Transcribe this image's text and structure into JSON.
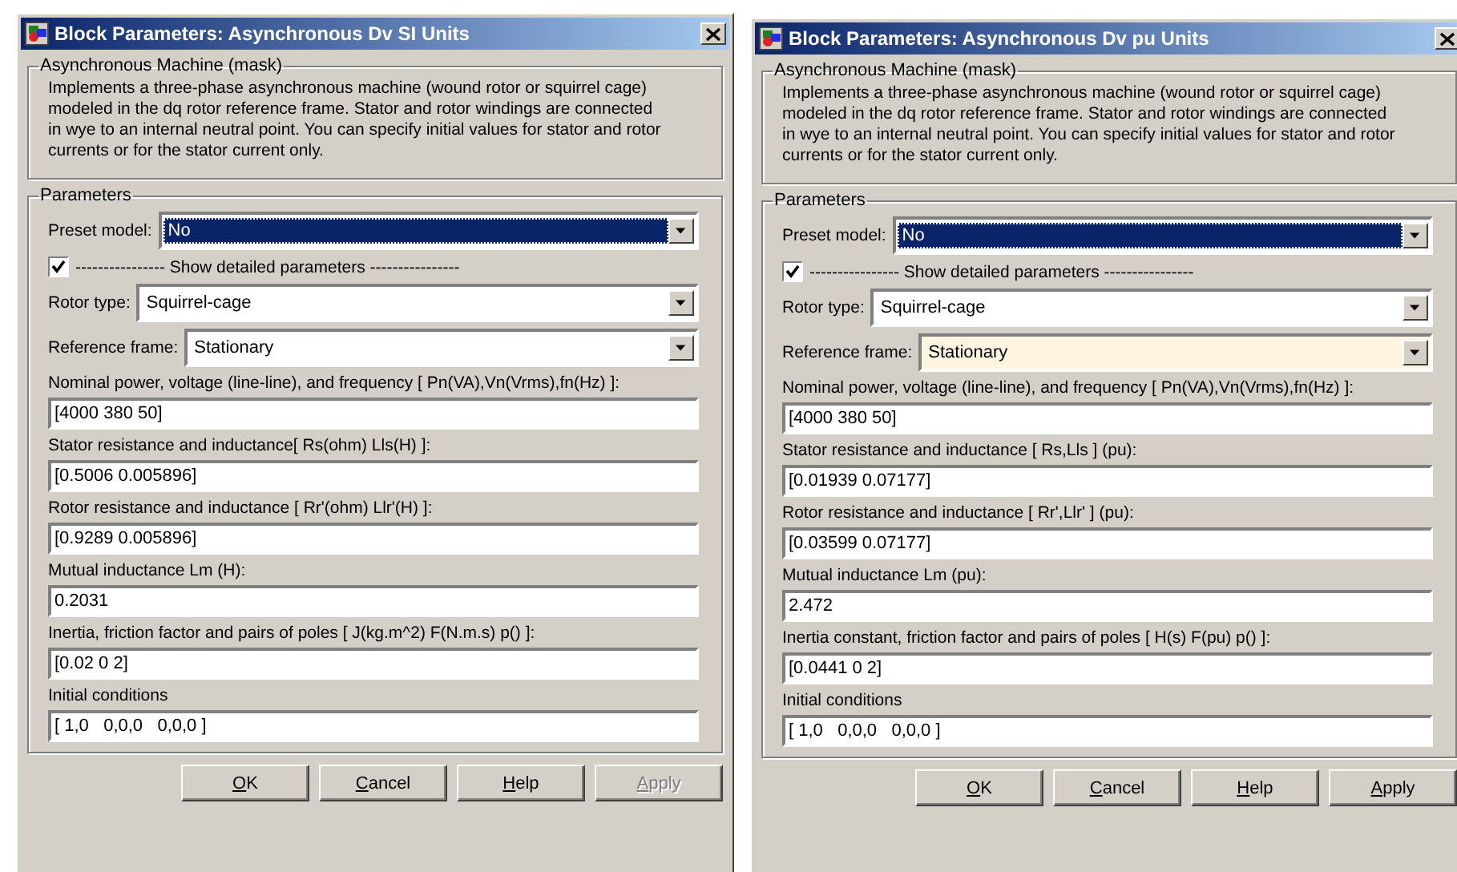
{
  "dialogs": [
    {
      "title": "Block Parameters: Asynchronous Dv SI Units",
      "mask": {
        "legend": "Asynchronous Machine (mask)",
        "description": "Implements a three-phase asynchronous machine (wound rotor or squirrel cage)\nmodeled in the dq rotor reference frame. Stator and rotor windings are connected\nin wye to an internal neutral point. You can specify initial values for stator and rotor\ncurrents or for  the stator current only."
      },
      "parameters": {
        "legend": "Parameters",
        "preset": {
          "label": "Preset model:",
          "value": "No",
          "highlighted": true,
          "focused": false
        },
        "detail": {
          "checked": true,
          "label": "---------------- Show detailed parameters ----------------"
        },
        "selects": [
          {
            "label": "Rotor type:",
            "value": "Squirrel-cage",
            "highlighted": false,
            "focused": false
          },
          {
            "label": "Reference frame:",
            "value": "Stationary",
            "highlighted": false,
            "focused": false
          }
        ],
        "fields": [
          {
            "label": "Nominal power, voltage (line-line), and frequency [ Pn(VA),Vn(Vrms),fn(Hz) ]:",
            "value": "[4000 380 50]"
          },
          {
            "label": "Stator resistance and inductance[ Rs(ohm)  Lls(H) ]:",
            "value": "[0.5006 0.005896]"
          },
          {
            "label": "Rotor resistance and inductance [ Rr'(ohm)  Llr'(H) ]:",
            "value": "[0.9289 0.005896]"
          },
          {
            "label": "Mutual inductance Lm (H):",
            "value": "0.2031"
          },
          {
            "label": "Inertia, friction factor and pairs of poles [ J(kg.m^2)  F(N.m.s)  p() ]:",
            "value": "[0.02 0 2]"
          },
          {
            "label": "Initial conditions",
            "value": "[ 1,0   0,0,0   0,0,0 ]"
          }
        ]
      },
      "buttons": [
        {
          "label": "OK",
          "disabled": false
        },
        {
          "label": "Cancel",
          "disabled": false
        },
        {
          "label": "Help",
          "disabled": false
        },
        {
          "label": "Apply",
          "disabled": true
        }
      ]
    },
    {
      "title": "Block Parameters: Asynchronous Dv pu Units",
      "mask": {
        "legend": "Asynchronous Machine (mask)",
        "description": "Implements a three-phase asynchronous machine (wound rotor or squirrel cage)\nmodeled in the dq rotor reference frame. Stator and rotor windings are connected\nin wye to an internal neutral point. You can specify initial values for stator and rotor\ncurrents or for  the stator current only."
      },
      "parameters": {
        "legend": "Parameters",
        "preset": {
          "label": "Preset model:",
          "value": "No",
          "highlighted": true,
          "focused": false
        },
        "detail": {
          "checked": true,
          "label": "---------------- Show detailed parameters ----------------"
        },
        "selects": [
          {
            "label": "Rotor type:",
            "value": "Squirrel-cage",
            "highlighted": false,
            "focused": false
          },
          {
            "label": "Reference frame:",
            "value": "Stationary",
            "highlighted": false,
            "focused": true
          }
        ],
        "fields": [
          {
            "label": "Nominal power, voltage (line-line), and frequency  [ Pn(VA),Vn(Vrms),fn(Hz) ]:",
            "value": "[4000 380 50]"
          },
          {
            "label": "Stator resistance and inductance  [ Rs,Lls ] (pu):",
            "value": "[0.01939 0.07177]"
          },
          {
            "label": "Rotor resistance and inductance  [ Rr',Llr' ] (pu):",
            "value": "[0.03599 0.07177]"
          },
          {
            "label": "Mutual inductance Lm (pu):",
            "value": "2.472"
          },
          {
            "label": "Inertia constant, friction factor and pairs of poles [ H(s) F(pu) p() ]:",
            "value": "[0.0441 0 2]"
          },
          {
            "label": "Initial conditions",
            "value": "[ 1,0   0,0,0   0,0,0 ]"
          }
        ]
      },
      "buttons": [
        {
          "label": "OK",
          "disabled": false
        },
        {
          "label": "Cancel",
          "disabled": false
        },
        {
          "label": "Help",
          "disabled": false
        },
        {
          "label": "Apply",
          "disabled": false
        }
      ]
    }
  ]
}
